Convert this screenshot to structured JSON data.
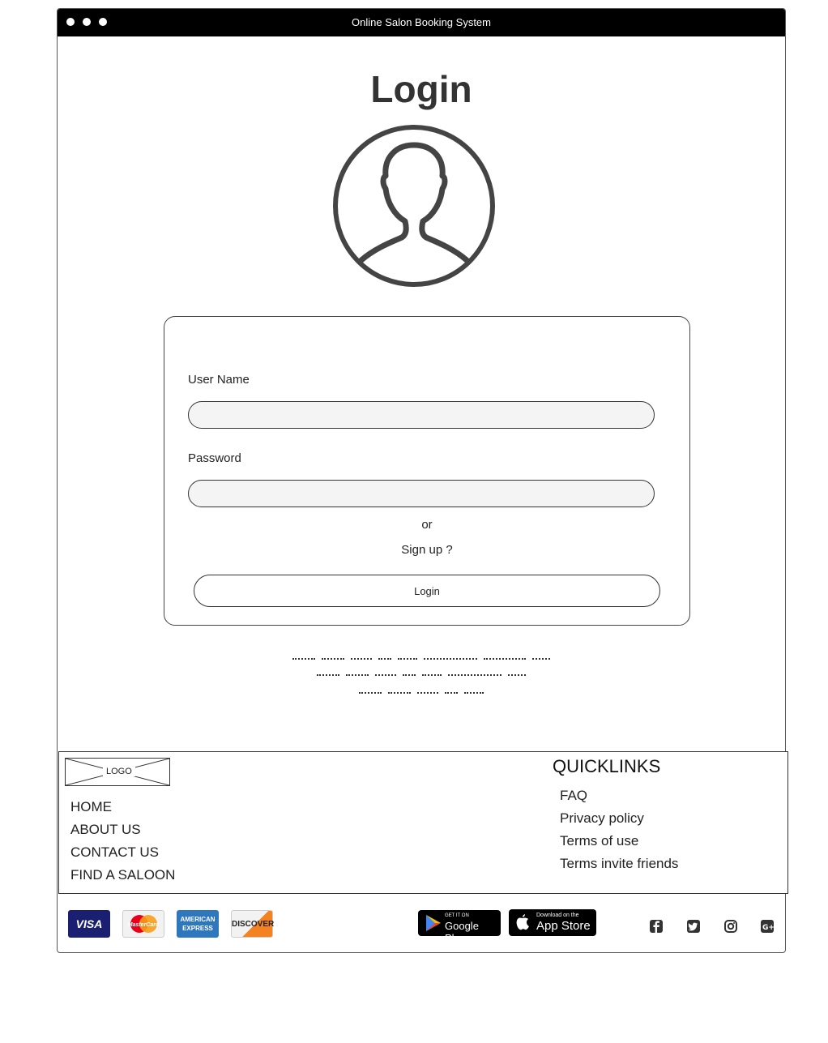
{
  "window": {
    "title": "Online Salon Booking System"
  },
  "page": {
    "title": "Login"
  },
  "form": {
    "username_label": "User Name",
    "username_value": "",
    "password_label": "Password",
    "password_value": "",
    "or_text": "or",
    "signup_text": "Sign up ?",
    "login_label": "Login"
  },
  "footer": {
    "logo_label": "LOGO",
    "nav": [
      "HOME",
      "ABOUT US",
      "CONTACT US",
      "FIND A SALOON"
    ],
    "quicklinks_title": "QUICKLINKS",
    "quicklinks": [
      "FAQ",
      "Privacy policy",
      "Terms of use",
      "Terms invite friends"
    ],
    "payments": [
      "VISA",
      "MasterCard",
      "AMERICAN EXPRESS",
      "DISCOVER"
    ],
    "stores": {
      "google_small": "GET IT ON",
      "google_big": "Google Play",
      "apple_small": "Download on the",
      "apple_big": "App Store"
    },
    "social_icons": [
      "facebook-icon",
      "twitter-icon",
      "instagram-icon",
      "google-plus-icon"
    ]
  },
  "colors": {
    "titlebar": "#000000",
    "visa": "#1a1f71",
    "mastercard_red": "#eb001b",
    "mastercard_orange": "#f79e1b",
    "amex": "#2e77bc",
    "discover": "#f58220"
  }
}
